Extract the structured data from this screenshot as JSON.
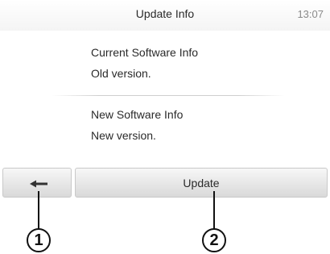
{
  "header": {
    "title": "Update Info",
    "clock": "13:07"
  },
  "current": {
    "heading": "Current Software Info",
    "value": "Old version."
  },
  "new": {
    "heading": "New Software Info",
    "value": "New version."
  },
  "toolbar": {
    "back_icon": "left-arrow-icon",
    "update_label": "Update"
  },
  "callouts": {
    "one": "1",
    "two": "2"
  }
}
